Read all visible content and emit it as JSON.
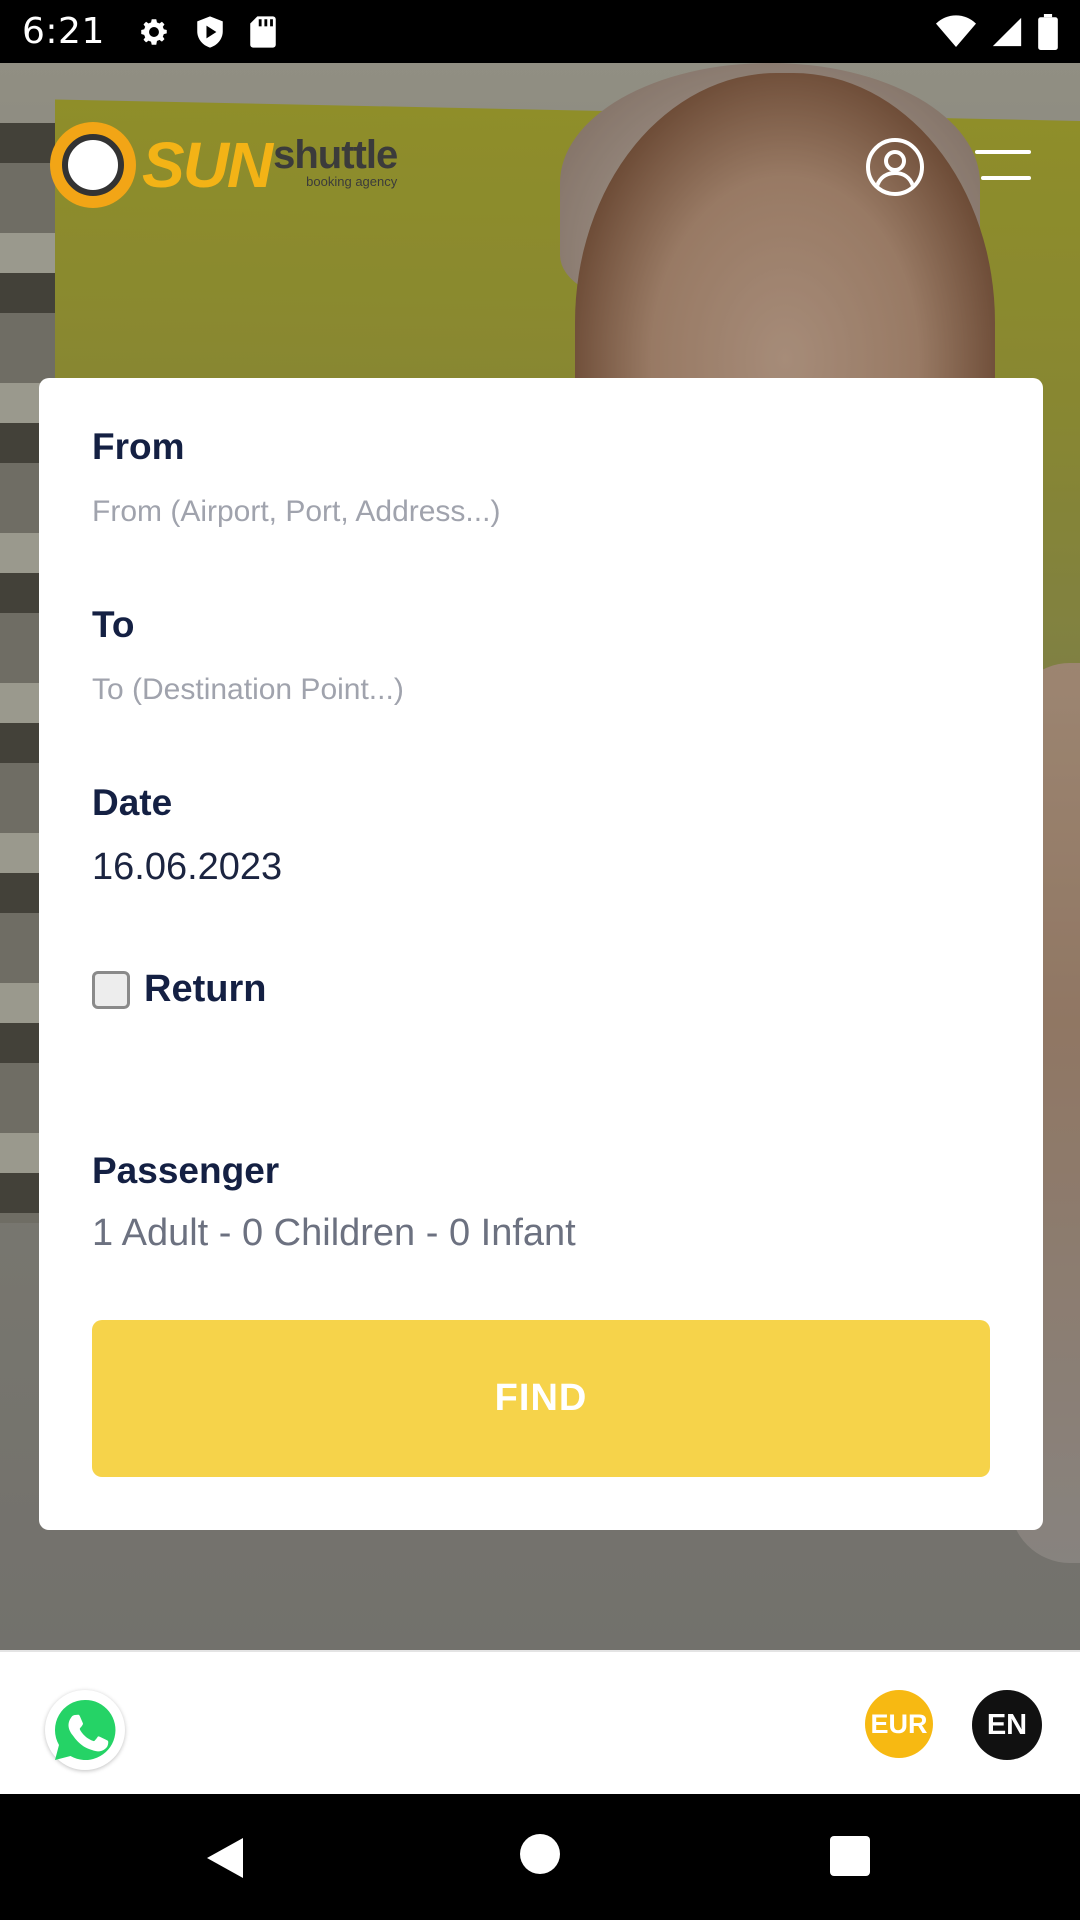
{
  "status_bar": {
    "time": "6:21",
    "left_icons": [
      "settings-icon",
      "play-protect-icon",
      "sd-card-icon"
    ],
    "right_icons": [
      "wifi-icon",
      "cell-signal-icon",
      "battery-icon"
    ]
  },
  "header": {
    "logo_sun": "SUN",
    "logo_shuttle": "shuttle",
    "logo_sub": "booking agency",
    "profile_icon": "user-circle-icon",
    "menu_icon": "hamburger-menu-icon"
  },
  "form": {
    "from_label": "From",
    "from_placeholder": "From (Airport, Port, Address...)",
    "to_label": "To",
    "to_placeholder": "To (Destination Point...)",
    "date_label": "Date",
    "date_value": "16.06.2023",
    "return_label": "Return",
    "return_checked": false,
    "passenger_label": "Passenger",
    "passenger_value": "1 Adult - 0 Children - 0 Infant",
    "find_label": "FIND"
  },
  "bottom_bar": {
    "whatsapp_icon": "whatsapp-icon",
    "currency": "EUR",
    "language": "EN"
  },
  "colors": {
    "accent_yellow": "#f6d34a",
    "currency_yellow": "#f7b912",
    "label_navy": "#142043",
    "whatsapp_green": "#25d366"
  }
}
